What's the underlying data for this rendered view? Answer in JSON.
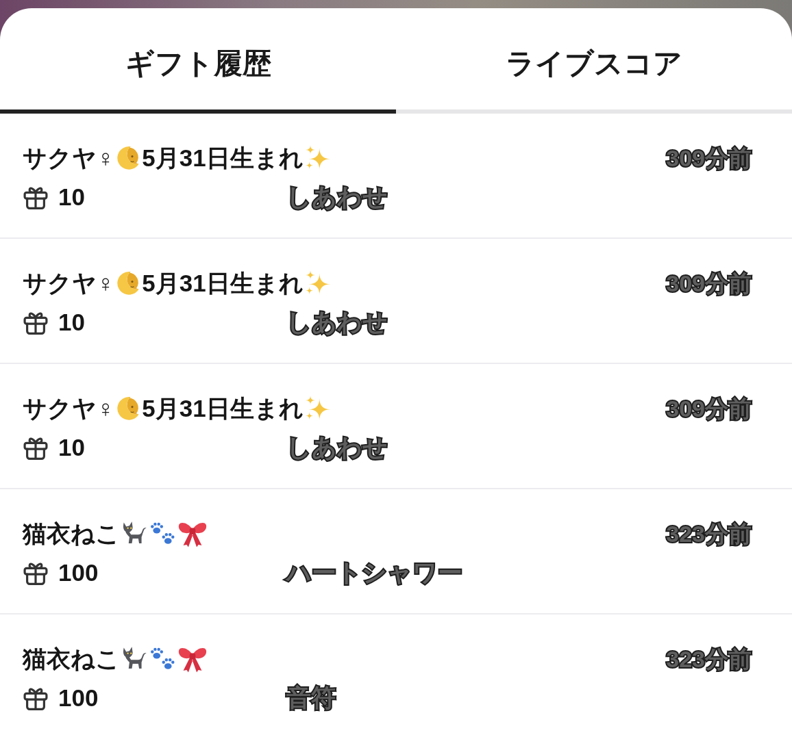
{
  "tabs": [
    {
      "label": "ギフト履歴",
      "selected": true
    },
    {
      "label": "ライブスコア",
      "selected": false
    }
  ],
  "gift_history": [
    {
      "sender": [
        {
          "kind": "text",
          "text": "サクヤ♀"
        },
        {
          "kind": "moon"
        },
        {
          "kind": "text",
          "text": "5月31日生まれ"
        },
        {
          "kind": "sparkles"
        }
      ],
      "amount": "10",
      "gift": "しあわせ",
      "time": "309分前"
    },
    {
      "sender": [
        {
          "kind": "text",
          "text": "サクヤ♀"
        },
        {
          "kind": "moon"
        },
        {
          "kind": "text",
          "text": "5月31日生まれ"
        },
        {
          "kind": "sparkles"
        }
      ],
      "amount": "10",
      "gift": "しあわせ",
      "time": "309分前"
    },
    {
      "sender": [
        {
          "kind": "text",
          "text": "サクヤ♀"
        },
        {
          "kind": "moon"
        },
        {
          "kind": "text",
          "text": "5月31日生まれ"
        },
        {
          "kind": "sparkles"
        }
      ],
      "amount": "10",
      "gift": "しあわせ",
      "time": "309分前"
    },
    {
      "sender": [
        {
          "kind": "text",
          "text": "猫衣ねこ"
        },
        {
          "kind": "cat"
        },
        {
          "kind": "paws"
        },
        {
          "kind": "bow"
        }
      ],
      "amount": "100",
      "gift": "ハートシャワー",
      "time": "323分前"
    },
    {
      "sender": [
        {
          "kind": "text",
          "text": "猫衣ねこ"
        },
        {
          "kind": "cat"
        },
        {
          "kind": "paws"
        },
        {
          "kind": "bow"
        }
      ],
      "amount": "100",
      "gift": "音符",
      "time": "323分前"
    }
  ]
}
